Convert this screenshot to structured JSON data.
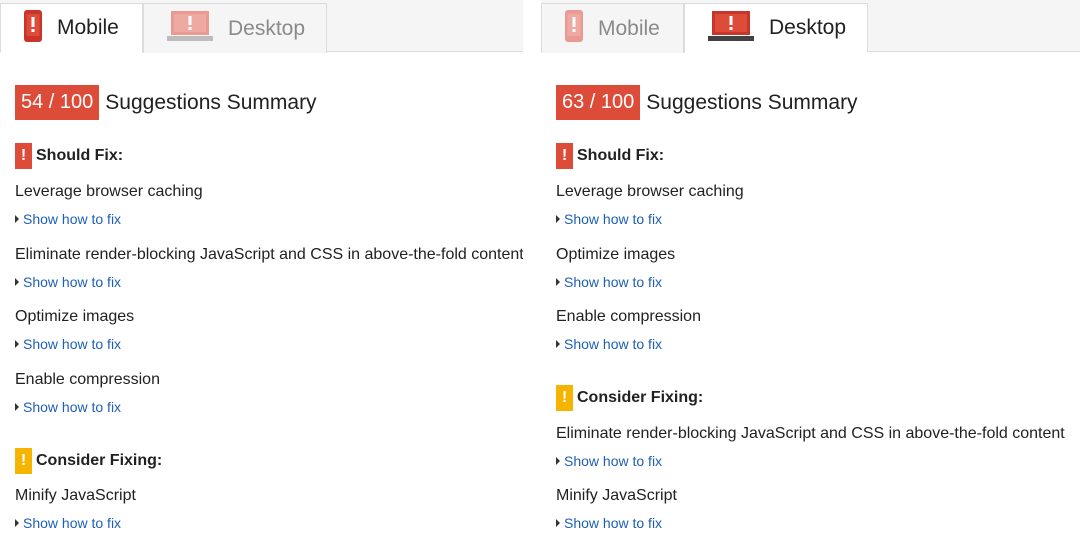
{
  "colors": {
    "score_badge": "#dd4b39",
    "should_fix": "#dd4b39",
    "consider_fixing": "#f4b400",
    "link": "#1e5fb4"
  },
  "left": {
    "tabs": [
      {
        "label": "Mobile",
        "icon": "phone-icon",
        "active": true
      },
      {
        "label": "Desktop",
        "icon": "monitor-icon",
        "active": false
      }
    ],
    "score": "54 / 100",
    "summary_title": "Suggestions Summary",
    "should_fix": {
      "icon_glyph": "!",
      "title": "Should Fix:",
      "rules": [
        {
          "title": "Leverage browser caching",
          "link": "Show how to fix"
        },
        {
          "title": "Eliminate render-blocking JavaScript and CSS in above-the-fold content",
          "link": "Show how to fix"
        },
        {
          "title": "Optimize images",
          "link": "Show how to fix"
        },
        {
          "title": "Enable compression",
          "link": "Show how to fix"
        }
      ]
    },
    "consider_fixing": {
      "icon_glyph": "!",
      "title": "Consider Fixing:",
      "rules": [
        {
          "title": "Minify JavaScript",
          "link": "Show how to fix"
        }
      ]
    }
  },
  "right": {
    "tabs": [
      {
        "label": "Mobile",
        "icon": "phone-icon",
        "active": false
      },
      {
        "label": "Desktop",
        "icon": "monitor-icon",
        "active": true
      }
    ],
    "score": "63 / 100",
    "summary_title": "Suggestions Summary",
    "should_fix": {
      "icon_glyph": "!",
      "title": "Should Fix:",
      "rules": [
        {
          "title": "Leverage browser caching",
          "link": "Show how to fix"
        },
        {
          "title": "Optimize images",
          "link": "Show how to fix"
        },
        {
          "title": "Enable compression",
          "link": "Show how to fix"
        }
      ]
    },
    "consider_fixing": {
      "icon_glyph": "!",
      "title": "Consider Fixing:",
      "rules": [
        {
          "title": "Eliminate render-blocking JavaScript and CSS in above-the-fold content",
          "link": "Show how to fix"
        },
        {
          "title": "Minify JavaScript",
          "link": "Show how to fix"
        }
      ]
    }
  }
}
